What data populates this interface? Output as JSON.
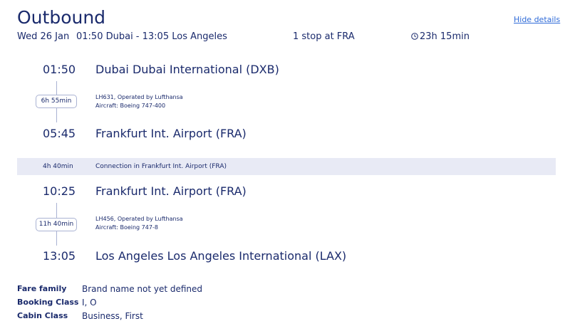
{
  "header": {
    "title": "Outbound",
    "hide_details": "Hide details"
  },
  "summary": {
    "date": "Wed 26 Jan",
    "route": "01:50 Dubai - 13:05 Los Angeles",
    "stops": "1 stop at FRA",
    "duration": "23h 15min"
  },
  "segments": [
    {
      "departure_time": "01:50",
      "departure_place": "Dubai Dubai International (DXB)",
      "flight_duration": "6h 55min",
      "flight": "LH631, Operated by Lufthansa",
      "aircraft": "Aircraft: Boeing 747-400",
      "arrival_time": "05:45",
      "arrival_place": "Frankfurt Int. Airport (FRA)"
    },
    {
      "departure_time": "10:25",
      "departure_place": "Frankfurt Int. Airport (FRA)",
      "flight_duration": "11h 40min",
      "flight": "LH456, Operated by Lufthansa",
      "aircraft": "Aircraft: Boeing 747-8",
      "arrival_time": "13:05",
      "arrival_place": "Los Angeles Los Angeles International (LAX)"
    }
  ],
  "connection": {
    "duration": "4h 40min",
    "text": "Connection in Frankfurt Int. Airport (FRA)"
  },
  "fare": {
    "family_label": "Fare family",
    "family_value": "Brand name not yet defined",
    "booking_label": "Booking Class",
    "booking_value": "I, O",
    "cabin_label": "Cabin Class",
    "cabin_value": "Business, First"
  },
  "icons": {
    "duration_icon": "clock-icon"
  },
  "colors": {
    "primary_text": "#1a2a6c",
    "link": "#2f6bd8",
    "connection_bg": "#e8eaf5",
    "timeline_line": "#aab3d3"
  }
}
